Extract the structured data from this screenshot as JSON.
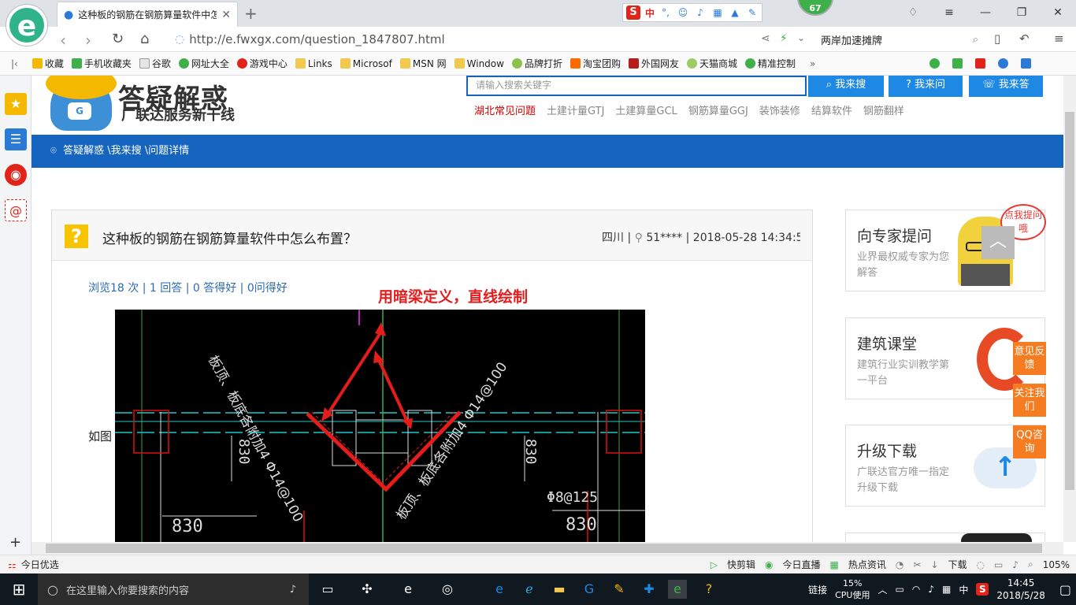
{
  "browser": {
    "tab_title": "这种板的钢筋在钢筋算量软件中怎么",
    "url": "http://e.fwxgx.com/question_1847807.html",
    "badge": "67",
    "search_text": "两岸加速摊牌",
    "ime": {
      "label": "中"
    },
    "bookmarks": [
      "收藏",
      "手机收藏夹",
      "谷歌",
      "网址大全",
      "游戏中心",
      "Links",
      "Microsof",
      "MSN 网",
      "Window",
      "品牌打折",
      "淘宝团购",
      "外国网友",
      "天猫商城",
      "精准控制"
    ],
    "bookmark_more": "»",
    "status": {
      "left": "今日优选",
      "items": [
        "快剪辑",
        "今日直播",
        "热点资讯",
        "下载"
      ],
      "zoom": "105%"
    }
  },
  "site": {
    "logo_title": "答疑解惑",
    "logo_subtitle": "广联达服务新干线",
    "search_placeholder": "请输入搜索关键字",
    "buttons": [
      "我来搜",
      "我来问",
      "我来答"
    ],
    "hot_links": [
      "湖北常见问题",
      "土建计量GTJ",
      "土建算量GCL",
      "钢筋算量GGJ",
      "装饰装修",
      "结算软件",
      "钢筋翻样"
    ],
    "breadcrumb": "答疑解惑 \\我来搜 \\问题详情"
  },
  "question": {
    "title": "这种板的钢筋在钢筋算量软件中怎么布置？",
    "meta_region": "四川",
    "meta_user": "51****",
    "meta_time": "2018-05-28 14:34:5",
    "stats": "浏览18 次 | 1 回答 | 0 答得好 | 0问得好",
    "body_prefix": "如图",
    "annotation": "用暗梁定义，直线绘制",
    "cad_labels": [
      "板顶、板底各附加4 Φ14@100",
      "板顶、板底各附加4 Φ14@100",
      "830",
      "830",
      "830",
      "830",
      "Φ8@125"
    ]
  },
  "right": {
    "boxes": [
      {
        "title": "向专家提问",
        "desc": "业界最权威专家为您解答"
      },
      {
        "title": "建筑课堂",
        "desc": "建筑行业实训教学第一平台"
      },
      {
        "title": "升级下载",
        "desc": "广联达官方唯一指定升级下载"
      }
    ],
    "bubble": "点我提问哦",
    "float_buttons": [
      "意见反馈",
      "关注我们",
      "QQ咨询"
    ]
  },
  "taskbar": {
    "search_placeholder": "在这里输入你要搜索的内容",
    "link_label": "链接",
    "cpu_percent": "15%",
    "cpu_label": "CPU使用",
    "ime": "中",
    "time": "14:45",
    "date": "2018/5/28"
  }
}
